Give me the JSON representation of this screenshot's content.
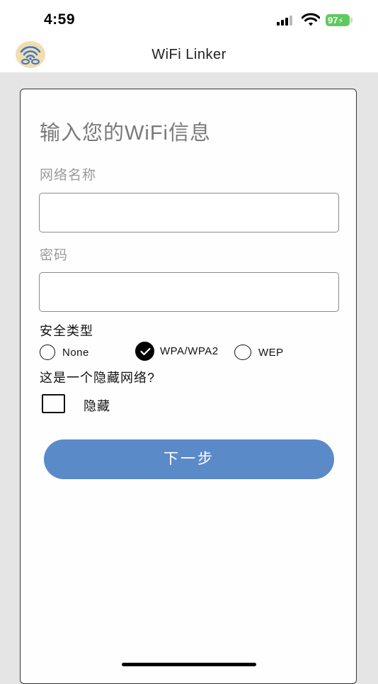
{
  "status_bar": {
    "time": "4:59",
    "battery_level": "97"
  },
  "header": {
    "title": "WiFi Linker",
    "logo_icon": "wifi-logo-icon"
  },
  "form": {
    "heading": "输入您的WiFi信息",
    "network_name_label": "网络名称",
    "network_name_value": "",
    "password_label": "密码",
    "password_value": "",
    "security_label": "安全类型",
    "security_options": [
      {
        "label": "None",
        "selected": false
      },
      {
        "label": "WPA/WPA2",
        "selected": true
      },
      {
        "label": "WEP",
        "selected": false
      }
    ],
    "hidden_question": "这是一个隐藏网络?",
    "hidden_checkbox_label": "隐藏",
    "hidden_checked": false,
    "next_button_label": "下一步"
  },
  "colors": {
    "accent": "#5b8ac8",
    "battery": "#5ec95e",
    "page_background": "#e5e5e5"
  }
}
